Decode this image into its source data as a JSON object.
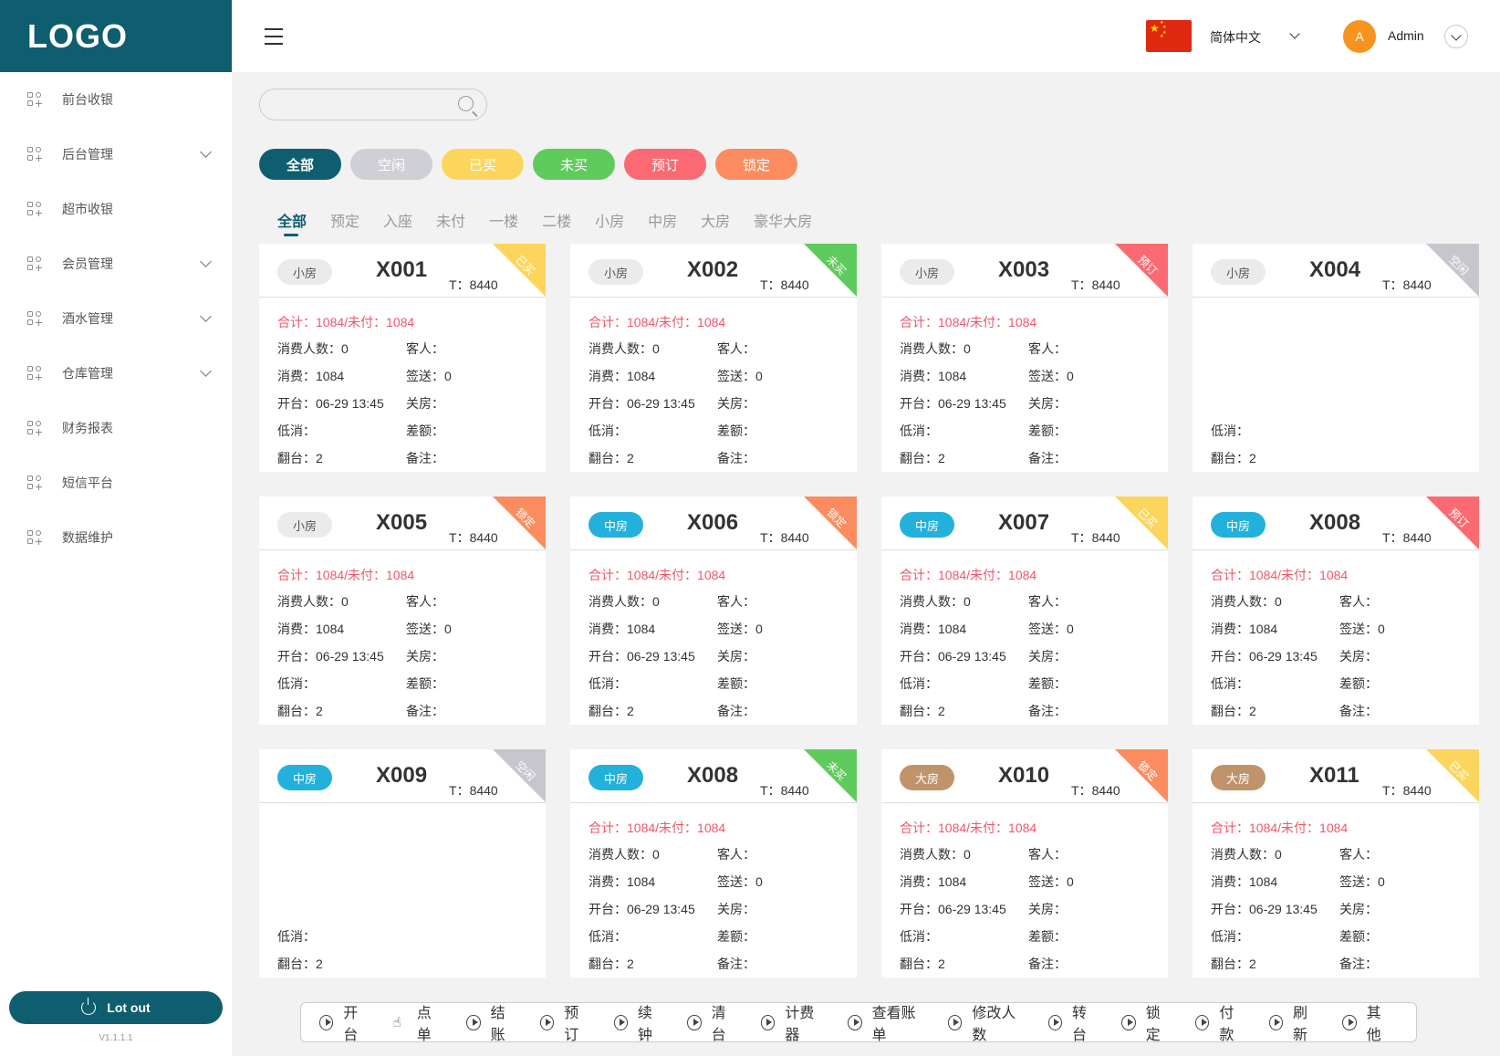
{
  "logo": "LOGO",
  "sidebar": {
    "items": [
      {
        "label": "前台收银",
        "expandable": false
      },
      {
        "label": "后台管理",
        "expandable": true
      },
      {
        "label": "超市收银",
        "expandable": false
      },
      {
        "label": "会员管理",
        "expandable": true
      },
      {
        "label": "酒水管理",
        "expandable": true
      },
      {
        "label": "仓库管理",
        "expandable": true
      },
      {
        "label": "财务报表",
        "expandable": false
      },
      {
        "label": "短信平台",
        "expandable": false
      },
      {
        "label": "数据维护",
        "expandable": false
      }
    ],
    "logout_label": "Lot out",
    "version": "V1.1.1.1"
  },
  "header": {
    "language": "简体中文",
    "avatar_letter": "A",
    "user_name": "Admin"
  },
  "search": {
    "placeholder": ""
  },
  "status_filters": [
    {
      "label": "全部",
      "color": "#0e5e6f"
    },
    {
      "label": "空闲",
      "color": "#cfcfd6"
    },
    {
      "label": "已买",
      "color": "#fcd65c"
    },
    {
      "label": "未买",
      "color": "#5fcb5d"
    },
    {
      "label": "预订",
      "color": "#fb6a72"
    },
    {
      "label": "锁定",
      "color": "#fb8c5f"
    }
  ],
  "tabs": [
    "全部",
    "预定",
    "入座",
    "未付",
    "一楼",
    "二楼",
    "小房",
    "中房",
    "大房",
    "豪华大房"
  ],
  "active_tab": "全部",
  "labels": {
    "t": "T：",
    "guests": "消费人数：",
    "customer": "客人：",
    "spend": "消费：",
    "gift": "签送：",
    "open": "开台：",
    "close": "关房：",
    "min": "低消：",
    "diff": "差额：",
    "turn": "翻台：",
    "note": "备注："
  },
  "room_type_colors": {
    "小房": {
      "bg": "#ebebeb",
      "fg": "#555555"
    },
    "中房": {
      "bg": "#23b1dc",
      "fg": "#ffffff"
    },
    "大房": {
      "bg": "#c0946a",
      "fg": "#ffffff"
    }
  },
  "status_colors": {
    "已买": "#fcd65c",
    "未买": "#5fcb5d",
    "预订": "#fb6a72",
    "空闲": "#c6c6cc",
    "锁定": "#fb8c5f"
  },
  "rooms": [
    {
      "type": "小房",
      "no": "X001",
      "t": "8440",
      "status": "已买",
      "total": "合计：1084/未付：1084",
      "guests": "0",
      "customer": "",
      "spend": "1084",
      "gift": "0",
      "open": "06-29 13:45",
      "close": "",
      "min": "",
      "diff": "",
      "turn": "2",
      "note": "",
      "idle": false
    },
    {
      "type": "小房",
      "no": "X002",
      "t": "8440",
      "status": "未买",
      "total": "合计：1084/未付：1084",
      "guests": "0",
      "customer": "",
      "spend": "1084",
      "gift": "0",
      "open": "06-29 13:45",
      "close": "",
      "min": "",
      "diff": "",
      "turn": "2",
      "note": "",
      "idle": false
    },
    {
      "type": "小房",
      "no": "X003",
      "t": "8440",
      "status": "预订",
      "total": "合计：1084/未付：1084",
      "guests": "0",
      "customer": "",
      "spend": "1084",
      "gift": "0",
      "open": "06-29 13:45",
      "close": "",
      "min": "",
      "diff": "",
      "turn": "2",
      "note": "",
      "idle": false
    },
    {
      "type": "小房",
      "no": "X004",
      "t": "8440",
      "status": "空闲",
      "total": "",
      "min": "",
      "turn": "2",
      "idle": true
    },
    {
      "type": "小房",
      "no": "X005",
      "t": "8440",
      "status": "锁定",
      "total": "合计：1084/未付：1084",
      "guests": "0",
      "customer": "",
      "spend": "1084",
      "gift": "0",
      "open": "06-29 13:45",
      "close": "",
      "min": "",
      "diff": "",
      "turn": "2",
      "note": "",
      "idle": false
    },
    {
      "type": "中房",
      "no": "X006",
      "t": "8440",
      "status": "锁定",
      "total": "合计：1084/未付：1084",
      "guests": "0",
      "customer": "",
      "spend": "1084",
      "gift": "0",
      "open": "06-29 13:45",
      "close": "",
      "min": "",
      "diff": "",
      "turn": "2",
      "note": "",
      "idle": false
    },
    {
      "type": "中房",
      "no": "X007",
      "t": "8440",
      "status": "已买",
      "total": "合计：1084/未付：1084",
      "guests": "0",
      "customer": "",
      "spend": "1084",
      "gift": "0",
      "open": "06-29 13:45",
      "close": "",
      "min": "",
      "diff": "",
      "turn": "2",
      "note": "",
      "idle": false
    },
    {
      "type": "中房",
      "no": "X008",
      "t": "8440",
      "status": "预订",
      "total": "合计：1084/未付：1084",
      "guests": "0",
      "customer": "",
      "spend": "1084",
      "gift": "0",
      "open": "06-29 13:45",
      "close": "",
      "min": "",
      "diff": "",
      "turn": "2",
      "note": "",
      "idle": false
    },
    {
      "type": "中房",
      "no": "X009",
      "t": "8440",
      "status": "空闲",
      "total": "",
      "min": "",
      "turn": "2",
      "idle": true
    },
    {
      "type": "中房",
      "no": "X008",
      "t": "8440",
      "status": "未买",
      "total": "合计：1084/未付：1084",
      "guests": "0",
      "customer": "",
      "spend": "1084",
      "gift": "0",
      "open": "06-29 13:45",
      "close": "",
      "min": "",
      "diff": "",
      "turn": "2",
      "note": "",
      "idle": false
    },
    {
      "type": "大房",
      "no": "X010",
      "t": "8440",
      "status": "锁定",
      "total": "合计：1084/未付：1084",
      "guests": "0",
      "customer": "",
      "spend": "1084",
      "gift": "0",
      "open": "06-29 13:45",
      "close": "",
      "min": "",
      "diff": "",
      "turn": "2",
      "note": "",
      "idle": false
    },
    {
      "type": "大房",
      "no": "X011",
      "t": "8440",
      "status": "已买",
      "total": "合计：1084/未付：1084",
      "guests": "0",
      "customer": "",
      "spend": "1084",
      "gift": "0",
      "open": "06-29 13:45",
      "close": "",
      "min": "",
      "diff": "",
      "turn": "2",
      "note": "",
      "idle": false
    }
  ],
  "actions": [
    {
      "label": "开台",
      "icon": "play-circle-icon"
    },
    {
      "label": "点单",
      "icon": "hand-pointer-icon"
    },
    {
      "label": "结账",
      "icon": "play-circle-icon"
    },
    {
      "label": "预订",
      "icon": "play-circle-icon"
    },
    {
      "label": "续钟",
      "icon": "play-circle-icon"
    },
    {
      "label": "清台",
      "icon": "play-circle-icon"
    },
    {
      "label": "计费器",
      "icon": "play-circle-icon"
    },
    {
      "label": "查看账单",
      "icon": "play-circle-icon"
    },
    {
      "label": "修改人数",
      "icon": "play-circle-icon"
    },
    {
      "label": "转台",
      "icon": "play-circle-icon"
    },
    {
      "label": "锁定",
      "icon": "play-circle-icon"
    },
    {
      "label": "付款",
      "icon": "play-circle-icon"
    },
    {
      "label": "刷新",
      "icon": "play-circle-icon"
    },
    {
      "label": "其他",
      "icon": "play-circle-icon"
    }
  ]
}
